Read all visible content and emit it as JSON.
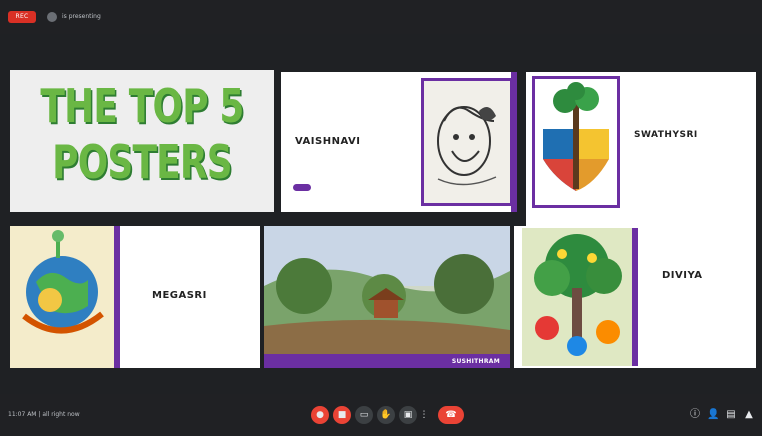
{
  "topbar": {
    "rec_label": "REC",
    "present_text": "is presenting"
  },
  "slides": {
    "title": {
      "line1": "THE TOP 5",
      "line2": "POSTERS"
    },
    "vaishnavi": {
      "name": "VAISHNAVI"
    },
    "swathysri": {
      "name": "SWATHYSRI"
    },
    "megasri": {
      "name": "MEGASRI"
    },
    "landscape": {
      "caption": "SUSHITHRAM"
    },
    "diviya": {
      "name": "DIVIYA"
    }
  },
  "colors": {
    "accent_purple": "#6b2fa2",
    "title_green": "#6ab744",
    "end_call_red": "#ea4335"
  },
  "bottombar": {
    "left_text": "11:07 AM | all right now",
    "icons": [
      "mic-icon",
      "camera-icon",
      "captions-icon",
      "hand-icon",
      "present-icon",
      "more-icon",
      "end-call-icon",
      "info-icon",
      "people-icon",
      "chat-icon",
      "activities-icon"
    ]
  }
}
